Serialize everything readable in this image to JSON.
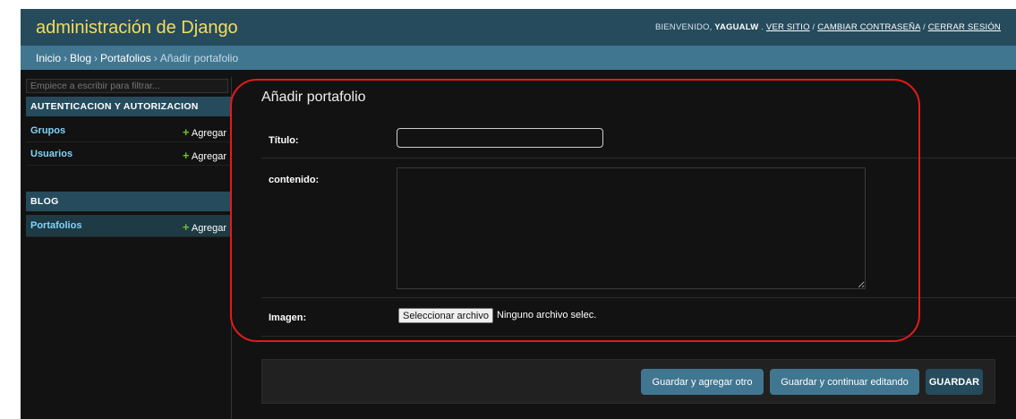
{
  "header": {
    "brand": "administración de Django",
    "welcome": "BIENVENIDO,",
    "username": "YAGUALW",
    "view_site": "VER SITIO",
    "change_password": "CAMBIAR CONTRASEÑA",
    "logout": "CERRAR SESIÓN",
    "separator": "/"
  },
  "breadcrumbs": {
    "items": [
      "Inicio",
      "Blog",
      "Portafolios"
    ],
    "current": "Añadir portafolio",
    "sep": "›"
  },
  "sidebar": {
    "filter_placeholder": "Empiece a escribir para filtrar...",
    "modules": [
      {
        "caption": "AUTENTICACION Y AUTORIZACION",
        "models": [
          {
            "name": "Grupos",
            "add": "Agregar"
          },
          {
            "name": "Usuarios",
            "add": "Agregar"
          }
        ]
      },
      {
        "caption": "BLOG",
        "models": [
          {
            "name": "Portafolios",
            "add": "Agregar",
            "active": true
          }
        ]
      }
    ],
    "add_icon": "+",
    "toggle_icon": "«"
  },
  "form": {
    "title": "Añadir portafolio",
    "fields": {
      "titulo_label": "Título:",
      "titulo_value": "",
      "contenido_label": "contenido:",
      "contenido_value": "",
      "imagen_label": "Imagen:",
      "file_button": "Seleccionar archivo",
      "file_status": "Ninguno archivo selec."
    },
    "buttons": {
      "save_add": "Guardar y agregar otro",
      "save_continue": "Guardar y continuar editando",
      "save": "GUARDAR"
    }
  },
  "colors": {
    "header_bg": "#264b5d",
    "breadcrumbs_bg": "#417690",
    "brand": "#f5dd5d",
    "link": "#81d4fa",
    "add_plus": "#70bf2b",
    "highlight": "#e21b1b"
  }
}
